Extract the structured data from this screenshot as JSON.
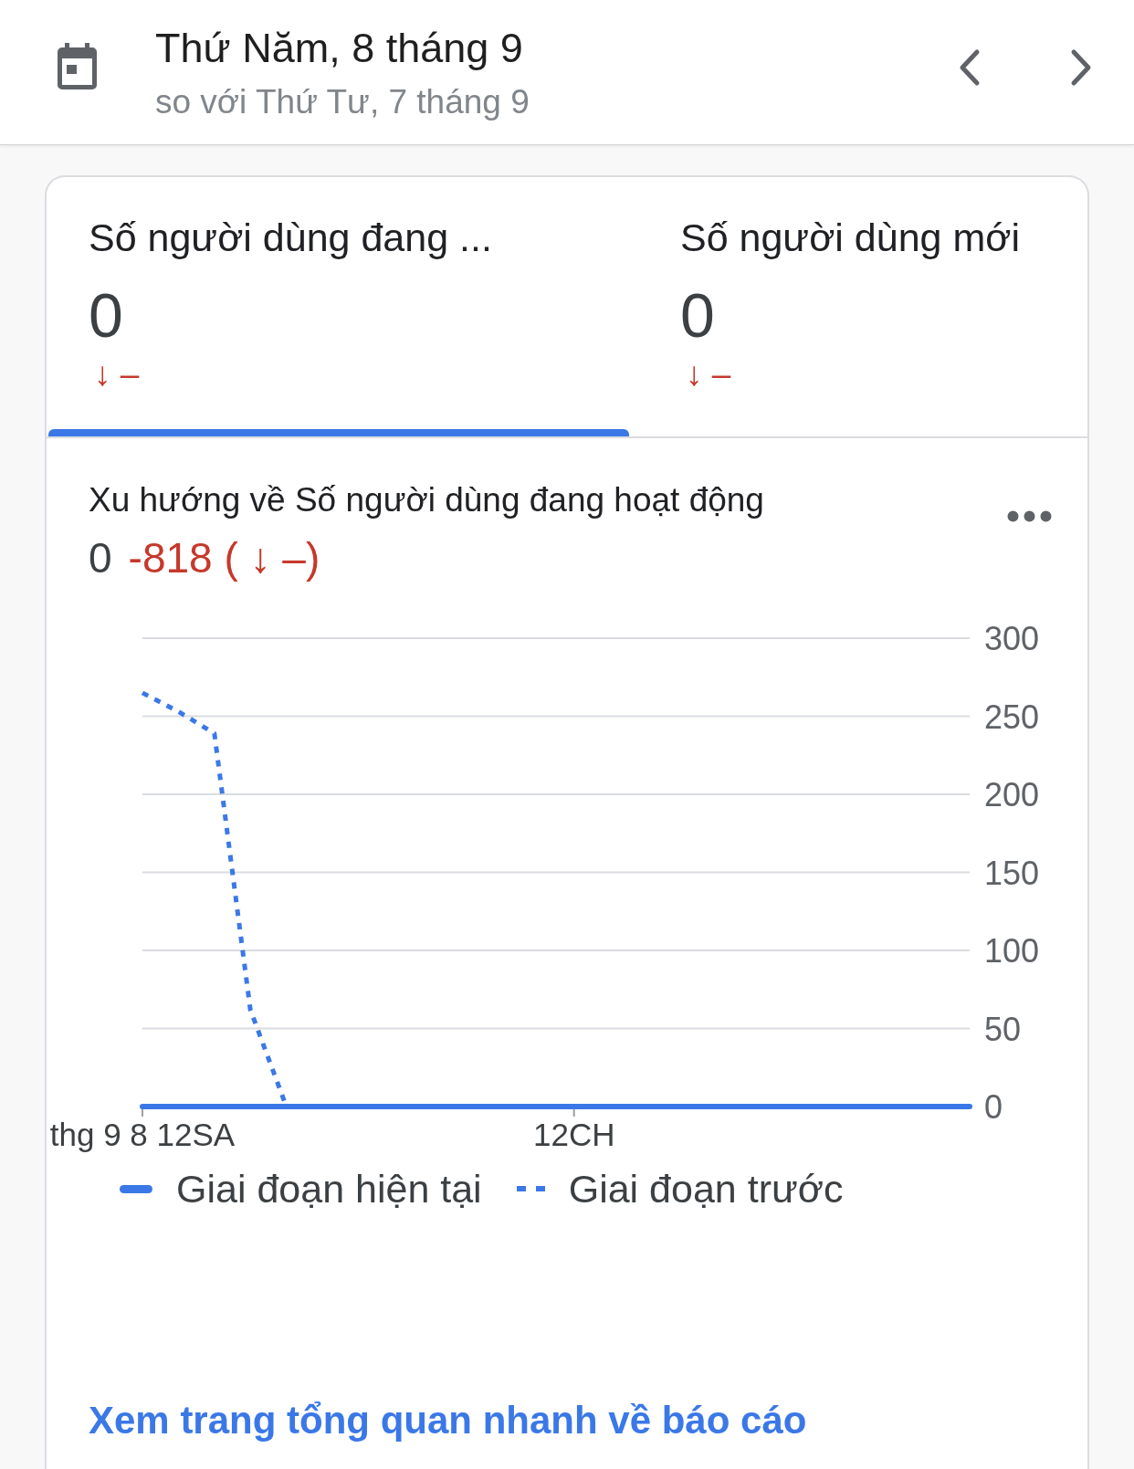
{
  "header": {
    "title": "Thứ Năm, 8 tháng 9",
    "subtitle": "so với Thứ Tư, 7 tháng 9"
  },
  "tabs": [
    {
      "label": "Số người dùng đang ...",
      "value": "0",
      "change": "↓ –",
      "selected": true
    },
    {
      "label": "Số người dùng mới",
      "value": "0",
      "change": "↓ –",
      "selected": false
    }
  ],
  "trend_card": {
    "title": "Xu hướng về Số người dùng đang hoạt động",
    "value": "0",
    "change": "-818 ( ↓ –)",
    "chart_data": {
      "type": "line",
      "categories": [
        "thg 9 8 12SA",
        null,
        null,
        null,
        null,
        null,
        null,
        null,
        null,
        null,
        null,
        null,
        "12CH",
        null,
        null,
        null,
        null,
        null,
        null,
        null,
        null,
        null,
        null,
        null
      ],
      "ylim": [
        0,
        300
      ],
      "yticks": [
        0,
        50,
        100,
        150,
        200,
        250,
        300
      ],
      "grid": "y",
      "legend": "bottom",
      "series": [
        {
          "name": "Giai đoạn hiện tại",
          "color": "#3b78e7",
          "line_style": "solid",
          "values": [
            0,
            0,
            0,
            0,
            0,
            0,
            0,
            0,
            0,
            0,
            0,
            0,
            0,
            0,
            0,
            0,
            0,
            0,
            0,
            0,
            0,
            0,
            0,
            0
          ]
        },
        {
          "name": "Giai đoạn trước",
          "color": "#3b78e7",
          "line_style": "dashed",
          "values": [
            265,
            253,
            239,
            62,
            0,
            0,
            0,
            0,
            0,
            0,
            0,
            0,
            0,
            0,
            0,
            0,
            0,
            0,
            0,
            0,
            0,
            0,
            0,
            0
          ]
        }
      ]
    }
  },
  "link": "Xem trang tổng quan nhanh về báo cáo"
}
